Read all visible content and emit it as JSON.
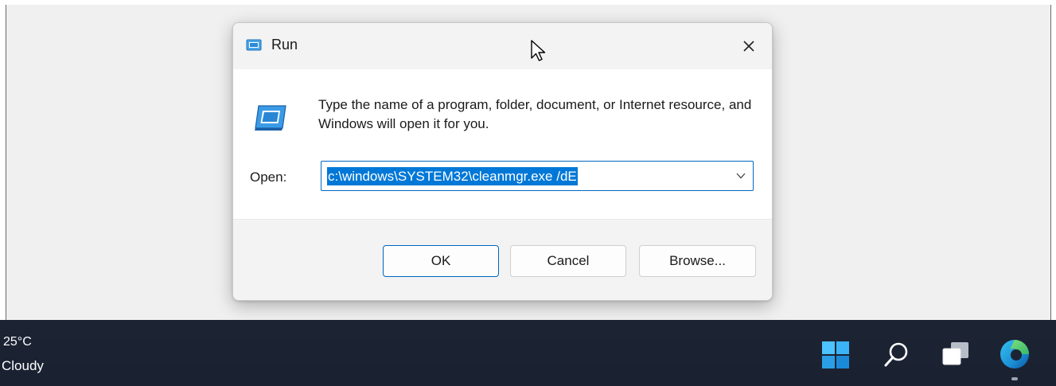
{
  "dialog": {
    "title": "Run",
    "icon": "run-app-icon",
    "close_icon": "close-icon",
    "prompt": "Type the name of a program, folder, document, or Internet resource, and Windows will open it for you.",
    "open_label": "Open:",
    "command_value": "c:\\windows\\SYSTEM32\\cleanmgr.exe /dE",
    "dropdown_icon": "chevron-down-icon",
    "buttons": {
      "ok": "OK",
      "cancel": "Cancel",
      "browse": "Browse..."
    }
  },
  "taskbar": {
    "weather_temp": "25°C",
    "weather_desc": "Cloudy",
    "icons": [
      "windows-start-icon",
      "search-icon",
      "task-view-icon",
      "edge-browser-icon"
    ]
  },
  "colors": {
    "accent": "#0067c0",
    "selection": "#0078d7",
    "taskbar": "#1c2434"
  }
}
